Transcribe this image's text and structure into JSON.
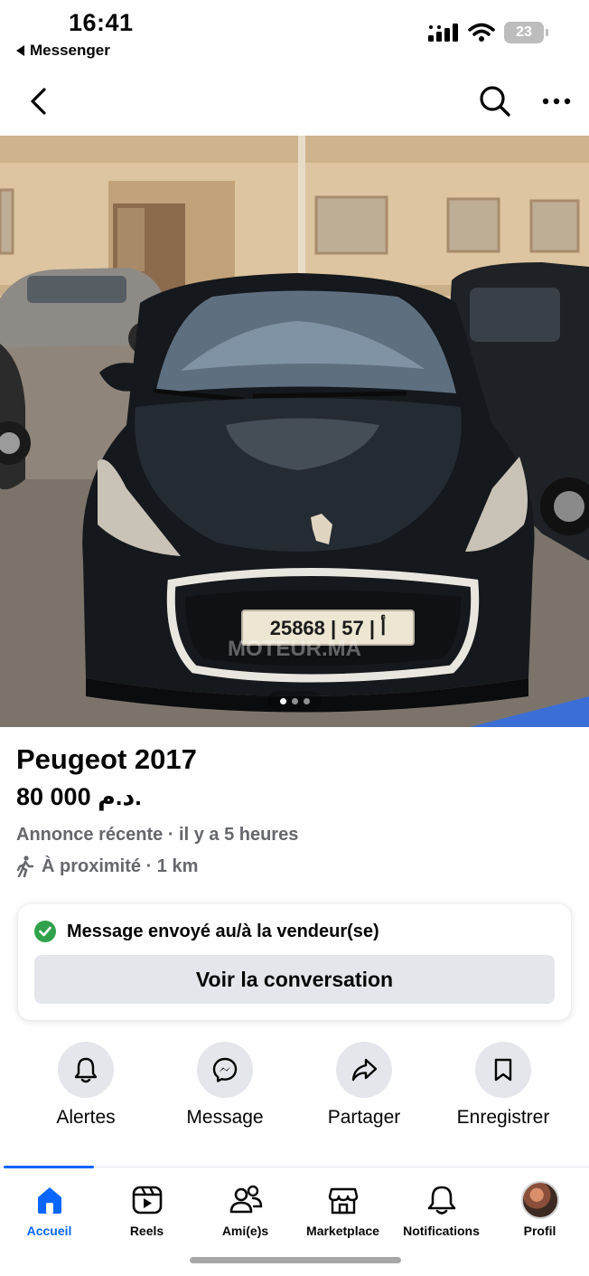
{
  "status_bar": {
    "time": "16:41",
    "back_app": "Messenger",
    "battery": "23",
    "icons": [
      "signal-icon",
      "wifi-icon",
      "battery-icon"
    ]
  },
  "top_nav": {
    "icons": [
      "back-chevron-icon",
      "search-icon",
      "more-icon"
    ]
  },
  "photo": {
    "plate_text": "25868 | أ | 57",
    "watermark": "MOTEUR.MA",
    "carousel_count": 3,
    "carousel_active": 1
  },
  "listing": {
    "title": "Peugeot 2017",
    "price": "80 000 د.م.",
    "meta": "Annonce récente · il y a 5 heures",
    "proximity": "À proximité · 1 km"
  },
  "message_card": {
    "status_text": "Message envoyé au/à la vendeur(se)",
    "button_label": "Voir la conversation",
    "status_color": "#31a24c"
  },
  "actions": [
    {
      "label": "Alertes",
      "icon": "bell-icon"
    },
    {
      "label": "Message",
      "icon": "messenger-icon"
    },
    {
      "label": "Partager",
      "icon": "share-icon"
    },
    {
      "label": "Enregistrer",
      "icon": "bookmark-icon"
    }
  ],
  "tabs": [
    {
      "label": "Accueil",
      "icon": "home-icon",
      "active": true
    },
    {
      "label": "Reels",
      "icon": "reels-icon",
      "active": false
    },
    {
      "label": "Ami(e)s",
      "icon": "friends-icon",
      "active": false
    },
    {
      "label": "Marketplace",
      "icon": "marketplace-icon",
      "active": false
    },
    {
      "label": "Notifications",
      "icon": "bell-icon",
      "active": false
    },
    {
      "label": "Profil",
      "icon": "avatar",
      "active": false
    }
  ],
  "colors": {
    "accent": "#0866ff",
    "secondary_text": "#65676b",
    "button_bg": "#e4e6eb"
  }
}
